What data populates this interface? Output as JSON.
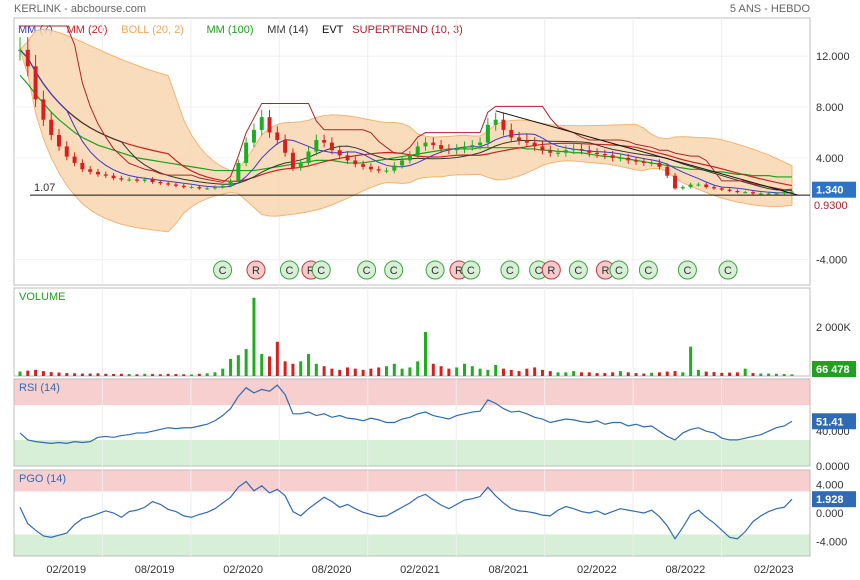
{
  "header": {
    "title": "KERLINK - abcbourse.com",
    "period": "5 ANS - HEBDO"
  },
  "legend": [
    {
      "label": "MM (7)",
      "color": "#3a3acb"
    },
    {
      "label": "MM (20)",
      "color": "#cc2222"
    },
    {
      "label": "BOLL (20, 2)",
      "color": "#f2a65a"
    },
    {
      "label": "MM (100)",
      "color": "#19a319"
    },
    {
      "label": "MM (14)",
      "color": "#333333"
    },
    {
      "label": "EVT",
      "color": "#111111"
    },
    {
      "label": "SUPERTREND (10, 3)",
      "color": "#b0232b"
    }
  ],
  "colors": {
    "up": "#1fae1f",
    "down": "#d62020",
    "boll_fill": "#f9d7b0",
    "rsi_line": "#2f6bb5",
    "zone_red": "#f7cfcf",
    "zone_green": "#d7eed7",
    "last_price_badge": "#2a73c5",
    "volume_badge": "#22a022"
  },
  "x_axis": {
    "ticks": [
      "02/2019",
      "08/2019",
      "02/2020",
      "08/2020",
      "02/2021",
      "08/2021",
      "02/2022",
      "08/2022",
      "02/2023"
    ]
  },
  "price_panel": {
    "y_ticks": [
      "12.000",
      "8.000",
      "4.000",
      "-4.000"
    ],
    "hline_label": "1.07",
    "last_value": "1.340",
    "hidden_value": "0.9300"
  },
  "events": [
    {
      "t": "C",
      "x": 0.262
    },
    {
      "t": "R",
      "x": 0.304
    },
    {
      "t": "C",
      "x": 0.346
    },
    {
      "t": "R",
      "x": 0.373
    },
    {
      "t": "C",
      "x": 0.386
    },
    {
      "t": "C",
      "x": 0.443
    },
    {
      "t": "C",
      "x": 0.477
    },
    {
      "t": "C",
      "x": 0.529
    },
    {
      "t": "R",
      "x": 0.559
    },
    {
      "t": "C",
      "x": 0.574
    },
    {
      "t": "C",
      "x": 0.623
    },
    {
      "t": "C",
      "x": 0.659
    },
    {
      "t": "R",
      "x": 0.675
    },
    {
      "t": "C",
      "x": 0.709
    },
    {
      "t": "R",
      "x": 0.743
    },
    {
      "t": "C",
      "x": 0.76
    },
    {
      "t": "C",
      "x": 0.797
    },
    {
      "t": "C",
      "x": 0.846
    },
    {
      "t": "C",
      "x": 0.897
    }
  ],
  "volume_panel": {
    "label": "VOLUME",
    "y_ticks": [
      "2 000K"
    ],
    "last_value": "66 478"
  },
  "rsi_panel": {
    "label": "RSI (14)",
    "y_ticks": [
      "40.000",
      "0.0000"
    ],
    "last_value": "51.41"
  },
  "pgo_panel": {
    "label": "PGO (14)",
    "y_ticks": [
      "4.000",
      "0.000",
      "-4.000"
    ],
    "last_value": "1.928"
  },
  "chart_data": {
    "type": "candlestick",
    "x_range": [
      "2018-07",
      "2023-07"
    ],
    "price": {
      "ylim": [
        -6,
        15
      ],
      "close": [
        12.5,
        11.2,
        8.6,
        7.0,
        5.8,
        4.9,
        4.1,
        3.6,
        3.1,
        2.9,
        2.7,
        2.6,
        2.4,
        2.3,
        2.3,
        2.2,
        2.3,
        2.1,
        2.0,
        1.9,
        1.8,
        1.7,
        1.7,
        1.6,
        1.6,
        1.7,
        1.8,
        2.2,
        3.6,
        5.2,
        6.2,
        7.2,
        6.0,
        5.4,
        4.4,
        3.2,
        3.6,
        4.5,
        5.4,
        5.2,
        4.6,
        4.2,
        3.8,
        3.5,
        3.3,
        3.1,
        3.0,
        3.0,
        3.4,
        3.8,
        4.2,
        4.9,
        5.2,
        5.0,
        4.7,
        4.6,
        4.7,
        4.9,
        5.0,
        5.2,
        6.6,
        7.0,
        6.2,
        5.6,
        5.4,
        5.2,
        4.9,
        4.6,
        4.4,
        4.4,
        4.6,
        4.7,
        4.6,
        4.4,
        4.3,
        4.2,
        4.0,
        4.0,
        3.8,
        3.7,
        3.6,
        3.6,
        3.3,
        2.6,
        1.6,
        1.7,
        1.9,
        1.9,
        1.7,
        1.6,
        1.5,
        1.4,
        1.3,
        1.3,
        1.2,
        1.2,
        1.2,
        1.2,
        1.3,
        1.34
      ],
      "mm100": [
        10.5,
        9.8,
        9.0,
        8.3,
        7.6,
        7.0,
        6.5,
        6.0,
        5.6,
        5.3,
        5.0,
        4.8,
        4.6,
        4.4,
        4.2,
        4.0,
        3.9,
        3.8,
        3.7,
        3.6,
        3.5,
        3.4,
        3.3,
        3.2,
        3.1,
        3.0,
        3.0,
        3.0,
        3.0,
        3.0,
        3.0,
        3.1,
        3.2,
        3.3,
        3.4,
        3.5,
        3.6,
        3.7,
        3.8,
        3.8,
        3.8,
        3.7,
        3.6,
        3.6,
        3.6,
        3.7,
        3.8,
        3.9,
        4.0,
        4.1,
        4.2,
        4.3,
        4.4,
        4.5,
        4.6,
        4.7,
        4.7,
        4.7,
        4.7,
        4.8,
        4.8,
        4.8,
        4.8,
        4.8,
        4.8,
        4.7,
        4.7,
        4.6,
        4.6,
        4.5,
        4.5,
        4.4,
        4.4,
        4.3,
        4.2,
        4.1,
        4.1,
        4.0,
        3.9,
        3.8,
        3.7,
        3.6,
        3.5,
        3.4,
        3.3,
        3.2,
        3.1,
        3.1,
        3.0,
        2.9,
        2.9,
        2.8,
        2.7,
        2.7,
        2.6,
        2.6,
        2.6,
        2.5,
        2.5,
        2.5
      ],
      "trendline_levels": [
        7.7,
        1.07
      ]
    },
    "volume": {
      "unit": "K",
      "ylim": [
        0,
        3600
      ],
      "values": [
        180,
        220,
        250,
        200,
        160,
        140,
        120,
        110,
        100,
        100,
        110,
        90,
        80,
        90,
        80,
        70,
        90,
        80,
        70,
        90,
        80,
        70,
        60,
        90,
        110,
        150,
        300,
        700,
        850,
        1100,
        3200,
        900,
        800,
        1400,
        600,
        500,
        600,
        900,
        500,
        400,
        300,
        250,
        350,
        300,
        250,
        300,
        350,
        400,
        500,
        300,
        350,
        600,
        1800,
        500,
        400,
        300,
        350,
        500,
        400,
        300,
        250,
        450,
        300,
        250,
        200,
        300,
        350,
        250,
        200,
        150,
        150,
        200,
        150,
        150,
        120,
        120,
        150,
        200,
        150,
        120,
        100,
        130,
        150,
        180,
        200,
        150,
        1200,
        250,
        180,
        160,
        130,
        140,
        150,
        300,
        120,
        100,
        100,
        90,
        80,
        66.478
      ]
    },
    "rsi": {
      "ylim": [
        0,
        100
      ],
      "zones": [
        30,
        70
      ],
      "values": [
        38,
        30,
        28,
        27,
        26,
        27,
        26,
        28,
        27,
        28,
        33,
        34,
        33,
        35,
        36,
        38,
        38,
        40,
        42,
        44,
        43,
        44,
        44,
        46,
        48,
        52,
        58,
        66,
        80,
        90,
        84,
        88,
        86,
        93,
        82,
        60,
        60,
        62,
        58,
        60,
        56,
        58,
        55,
        54,
        52,
        55,
        53,
        50,
        50,
        54,
        56,
        60,
        62,
        58,
        56,
        54,
        58,
        60,
        62,
        63,
        76,
        72,
        66,
        62,
        63,
        60,
        56,
        54,
        50,
        52,
        54,
        53,
        51,
        50,
        52,
        48,
        50,
        50,
        46,
        48,
        45,
        46,
        40,
        34,
        30,
        38,
        42,
        44,
        40,
        38,
        32,
        30,
        30,
        32,
        34,
        36,
        40,
        44,
        46,
        51.41
      ]
    },
    "pgo": {
      "ylim": [
        -6,
        6
      ],
      "zones": [
        -3,
        3
      ],
      "values": [
        0.8,
        -1.5,
        -2.4,
        -3.2,
        -3.4,
        -3.1,
        -2.8,
        -1.6,
        -0.8,
        -0.5,
        -0.1,
        0.3,
        0.0,
        -0.6,
        0.2,
        0.4,
        0.8,
        1.6,
        1.2,
        0.5,
        0.2,
        -0.4,
        -0.6,
        -0.2,
        0.1,
        0.6,
        1.4,
        2.2,
        3.6,
        4.4,
        3.1,
        3.8,
        2.8,
        3.3,
        2.4,
        0.2,
        -0.4,
        0.6,
        1.4,
        2.2,
        1.6,
        0.8,
        1.2,
        0.6,
        0.1,
        -0.2,
        -0.5,
        -0.4,
        0.2,
        0.8,
        1.4,
        2.2,
        2.6,
        1.8,
        1.1,
        0.6,
        1.2,
        1.8,
        2.0,
        2.3,
        3.6,
        2.4,
        1.4,
        0.6,
        0.3,
        0.2,
        0.0,
        -0.3,
        -0.4,
        0.4,
        0.9,
        0.6,
        0.2,
        0.0,
        0.3,
        -0.2,
        0.2,
        0.6,
        0.4,
        0.2,
        0.0,
        0.4,
        -0.5,
        -1.8,
        -3.6,
        -2.0,
        -0.2,
        0.4,
        -0.6,
        -1.4,
        -2.4,
        -3.4,
        -3.6,
        -2.6,
        -1.2,
        -0.4,
        0.2,
        0.6,
        0.8,
        1.928
      ]
    }
  }
}
